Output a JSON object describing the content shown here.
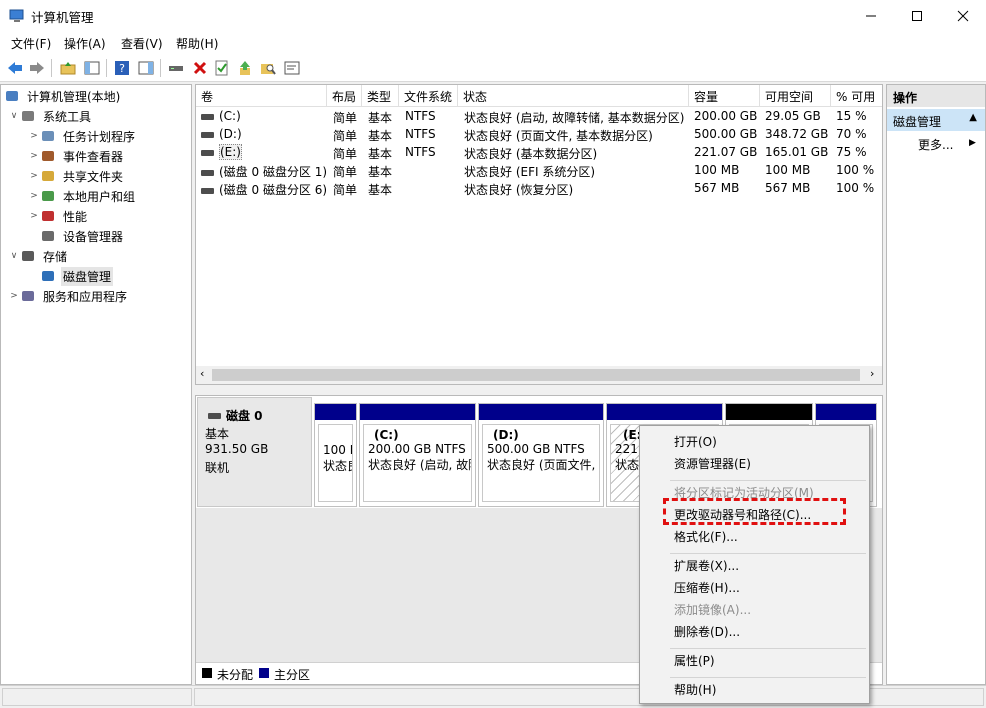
{
  "window": {
    "title": "计算机管理"
  },
  "menu": [
    "文件(F)",
    "操作(A)",
    "查看(V)",
    "帮助(H)"
  ],
  "tree": [
    {
      "label": "计算机管理(本地)",
      "arrow": "",
      "level": 0,
      "icon": "computer-management-icon"
    },
    {
      "label": "系统工具",
      "arrow": "∨",
      "level": 1,
      "icon": "system-tools-icon"
    },
    {
      "label": "任务计划程序",
      "arrow": ">",
      "level": 2,
      "icon": "clock-icon"
    },
    {
      "label": "事件查看器",
      "arrow": ">",
      "level": 2,
      "icon": "event-viewer-icon"
    },
    {
      "label": "共享文件夹",
      "arrow": ">",
      "level": 2,
      "icon": "shared-folder-icon"
    },
    {
      "label": "本地用户和组",
      "arrow": ">",
      "level": 2,
      "icon": "users-icon"
    },
    {
      "label": "性能",
      "arrow": ">",
      "level": 2,
      "icon": "performance-icon"
    },
    {
      "label": "设备管理器",
      "arrow": "",
      "level": 2,
      "icon": "device-manager-icon"
    },
    {
      "label": "存储",
      "arrow": "∨",
      "level": 1,
      "icon": "storage-icon"
    },
    {
      "label": "磁盘管理",
      "arrow": "",
      "level": 2,
      "icon": "disk-management-icon",
      "selected": true
    },
    {
      "label": "服务和应用程序",
      "arrow": ">",
      "level": 1,
      "icon": "services-icon"
    }
  ],
  "columns": [
    "卷",
    "布局",
    "类型",
    "文件系统",
    "状态",
    "容量",
    "可用空间",
    "% 可用"
  ],
  "volumes": [
    [
      "(C:)",
      "简单",
      "基本",
      "NTFS",
      "状态良好 (启动, 故障转储, 基本数据分区)",
      "200.00 GB",
      "29.05 GB",
      "15 %"
    ],
    [
      "(D:)",
      "简单",
      "基本",
      "NTFS",
      "状态良好 (页面文件, 基本数据分区)",
      "500.00 GB",
      "348.72 GB",
      "70 %"
    ],
    [
      "(E:)",
      "简单",
      "基本",
      "NTFS",
      "状态良好 (基本数据分区)",
      "221.07 GB",
      "165.01 GB",
      "75 %"
    ],
    [
      "(磁盘 0 磁盘分区 1)",
      "简单",
      "基本",
      "",
      "状态良好 (EFI 系统分区)",
      "100 MB",
      "100 MB",
      "100 %"
    ],
    [
      "(磁盘 0 磁盘分区 6)",
      "简单",
      "基本",
      "",
      "状态良好 (恢复分区)",
      "567 MB",
      "567 MB",
      "100 %"
    ]
  ],
  "disk": {
    "name": "磁盘 0",
    "type": "基本",
    "size": "931.50 GB",
    "status": "联机",
    "partitions": [
      {
        "line1": "",
        "line2": "100 M",
        "line3": "状态良"
      },
      {
        "line1": "(C:)",
        "line2": "200.00 GB NTFS",
        "line3": "状态良好 (启动, 故障"
      },
      {
        "line1": "(D:)",
        "line2": "500.00 GB NTFS",
        "line3": "状态良好 (页面文件,"
      },
      {
        "line1": "(E:)",
        "line2": "221.0",
        "line3": "状态"
      }
    ]
  },
  "legend": {
    "unallocated": "未分配",
    "primary": "主分区"
  },
  "actions": {
    "header": "操作",
    "selected": "磁盘管理",
    "more": "更多..."
  },
  "context_menu": [
    {
      "label": "打开(O)",
      "disabled": false
    },
    {
      "label": "资源管理器(E)",
      "disabled": false
    },
    {
      "sep": true
    },
    {
      "label": "将分区标记为活动分区(M)",
      "disabled": true
    },
    {
      "label": "更改驱动器号和路径(C)...",
      "disabled": false
    },
    {
      "label": "格式化(F)...",
      "disabled": false
    },
    {
      "sep": true
    },
    {
      "label": "扩展卷(X)...",
      "disabled": false
    },
    {
      "label": "压缩卷(H)...",
      "disabled": false
    },
    {
      "label": "添加镜像(A)...",
      "disabled": true
    },
    {
      "label": "删除卷(D)...",
      "disabled": false
    },
    {
      "sep": true
    },
    {
      "label": "属性(P)",
      "disabled": false
    },
    {
      "sep": true
    },
    {
      "label": "帮助(H)",
      "disabled": false
    }
  ],
  "colors": {
    "primary_partition": "#00008b",
    "unallocated": "#000000",
    "highlight": "#e01010"
  }
}
